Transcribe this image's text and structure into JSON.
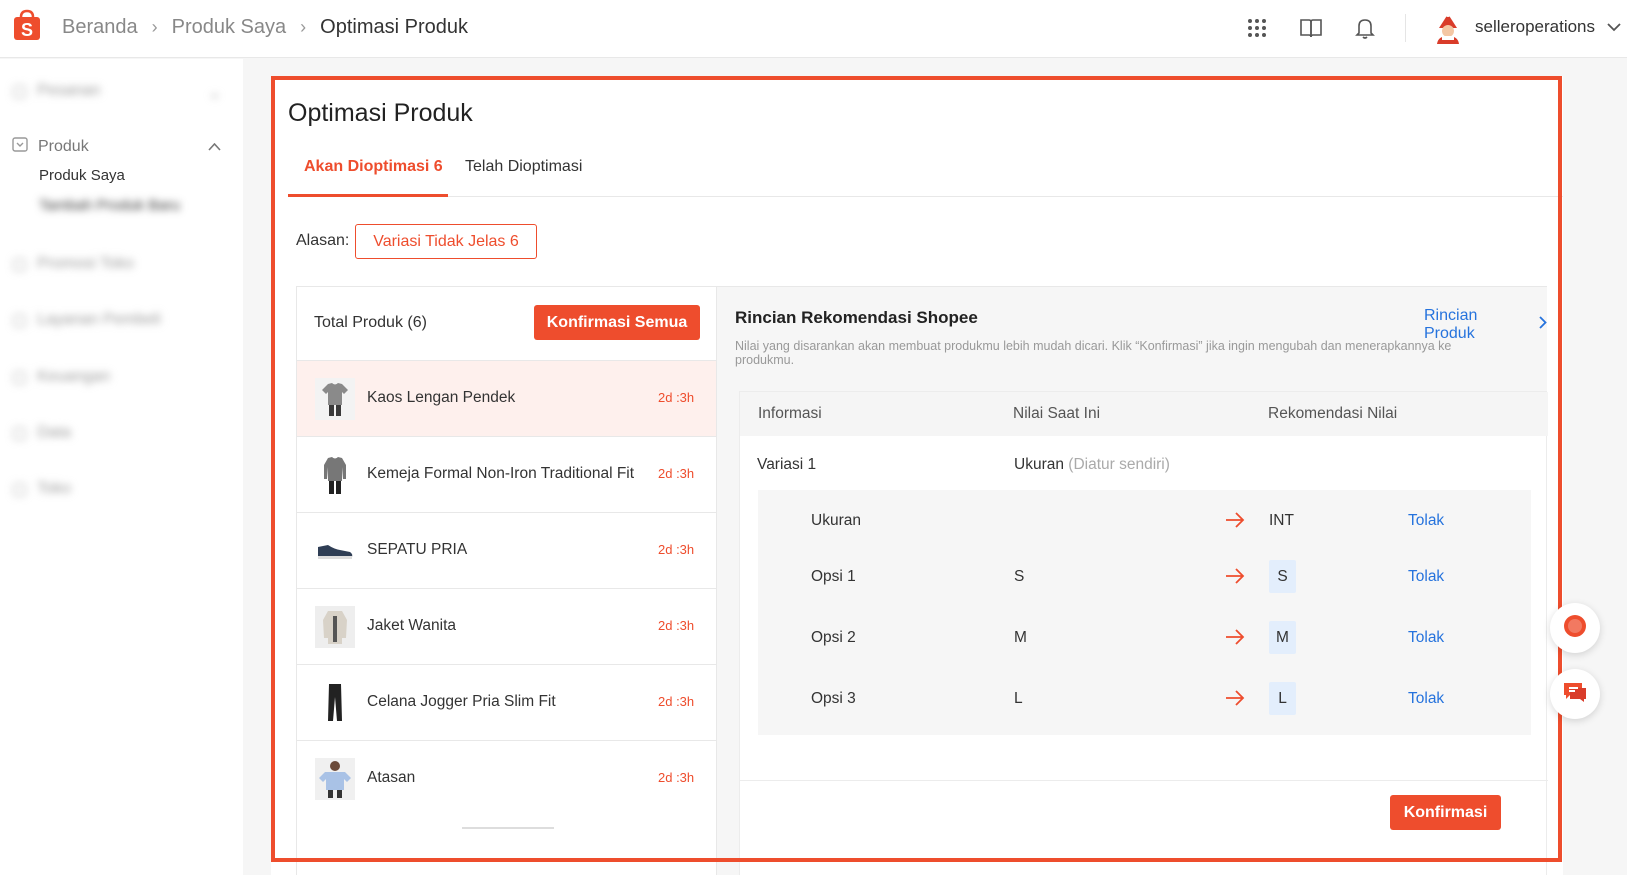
{
  "header": {
    "breadcrumbs": [
      "Beranda",
      "Produk Saya",
      "Optimasi Produk"
    ],
    "username": "selleroperations"
  },
  "sidebar": {
    "items": [
      {
        "label": "Pesanan"
      },
      {
        "label": "Produk"
      },
      {
        "label": "Promosi Toko"
      },
      {
        "label": "Layanan Pembeli"
      },
      {
        "label": "Keuangan"
      },
      {
        "label": "Data"
      },
      {
        "label": "Toko"
      }
    ],
    "sub_items": [
      "Produk Saya",
      "Tambah Produk Baru"
    ]
  },
  "page": {
    "title": "Optimasi Produk",
    "tabs": [
      {
        "label": "Akan Dioptimasi 6",
        "active": true
      },
      {
        "label": "Telah Dioptimasi",
        "active": false
      }
    ],
    "reason_label": "Alasan:",
    "reason_button": "Variasi Tidak Jelas 6"
  },
  "list": {
    "total_label": "Total Produk (6)",
    "confirm_all_label": "Konfirmasi Semua",
    "items": [
      {
        "name": "Kaos Lengan Pendek",
        "time": "2d :3h",
        "icon": "tshirt-icon",
        "active": true
      },
      {
        "name": "Kemeja Formal Non-Iron Traditional Fit",
        "time": "2d :3h",
        "icon": "shirt-icon",
        "active": false
      },
      {
        "name": "SEPATU PRIA",
        "time": "2d :3h",
        "icon": "shoe-icon",
        "active": false
      },
      {
        "name": "Jaket Wanita",
        "time": "2d :3h",
        "icon": "jacket-icon",
        "active": false
      },
      {
        "name": "Celana Jogger Pria Slim Fit",
        "time": "2d :3h",
        "icon": "pants-icon",
        "active": false
      },
      {
        "name": "Atasan",
        "time": "2d :3h",
        "icon": "blouse-icon",
        "active": false
      }
    ]
  },
  "detail": {
    "title": "Rincian Rekomendasi Shopee",
    "link_label": "Rincian Produk",
    "description": "Nilai yang disarankan akan membuat produkmu lebih mudah dicari. Klik “Konfirmasi” jika ingin mengubah dan menerapkannya ke produkmu.",
    "columns": [
      "Informasi",
      "Nilai Saat Ini",
      "Rekomendasi Nilai"
    ],
    "variation_label": "Variasi 1",
    "variation_current": "Ukuran",
    "variation_current_note": "(Diatur sendiri)",
    "rows": [
      {
        "label": "Ukuran",
        "current": "",
        "recommended": "INT",
        "chip": false,
        "action": "Tolak"
      },
      {
        "label": "Opsi 1",
        "current": "S",
        "recommended": "S",
        "chip": true,
        "action": "Tolak"
      },
      {
        "label": "Opsi 2",
        "current": "M",
        "recommended": "M",
        "chip": true,
        "action": "Tolak"
      },
      {
        "label": "Opsi 3",
        "current": "L",
        "recommended": "L",
        "chip": true,
        "action": "Tolak"
      }
    ],
    "confirm_label": "Konfirmasi"
  },
  "colors": {
    "brand": "#ee4d2d",
    "link": "#2673dd"
  }
}
